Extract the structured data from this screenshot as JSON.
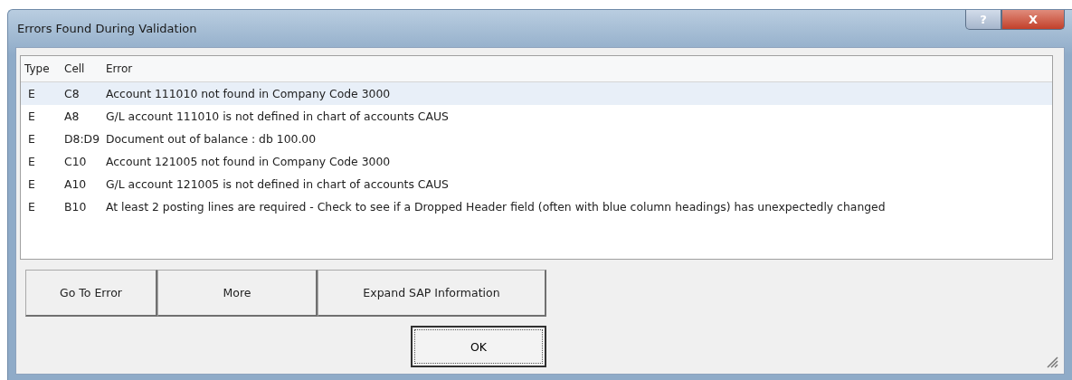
{
  "window": {
    "title": "Errors Found During Validation"
  },
  "title_buttons": [
    {
      "kind": "help",
      "label": "?"
    },
    {
      "kind": "close",
      "label": "X"
    }
  ],
  "table": {
    "columns": [
      "Type",
      "Cell",
      "Error"
    ],
    "rows": [
      {
        "type": "E",
        "cell": "C8",
        "error": "Account 111010 not found in Company Code 3000",
        "selected": true
      },
      {
        "type": "E",
        "cell": "A8",
        "error": "G/L account 111010 is not defined in chart of accounts CAUS",
        "selected": false
      },
      {
        "type": "E",
        "cell": "D8:D9",
        "error": "Document out of balance : db 100.00",
        "selected": false
      },
      {
        "type": "E",
        "cell": "C10",
        "error": "Account 121005 not found in Company Code 3000",
        "selected": false
      },
      {
        "type": "E",
        "cell": "A10",
        "error": "G/L account 121005 is not defined in chart of accounts CAUS",
        "selected": false
      },
      {
        "type": "E",
        "cell": "B10",
        "error": "At least 2 posting lines are required - Check to see if a Dropped Header field (often with blue column headings) has unexpectedly changed",
        "selected": false
      }
    ]
  },
  "buttons": [
    "Go To Error",
    "More",
    "Expand SAP Information"
  ],
  "ok_button": "OK"
}
